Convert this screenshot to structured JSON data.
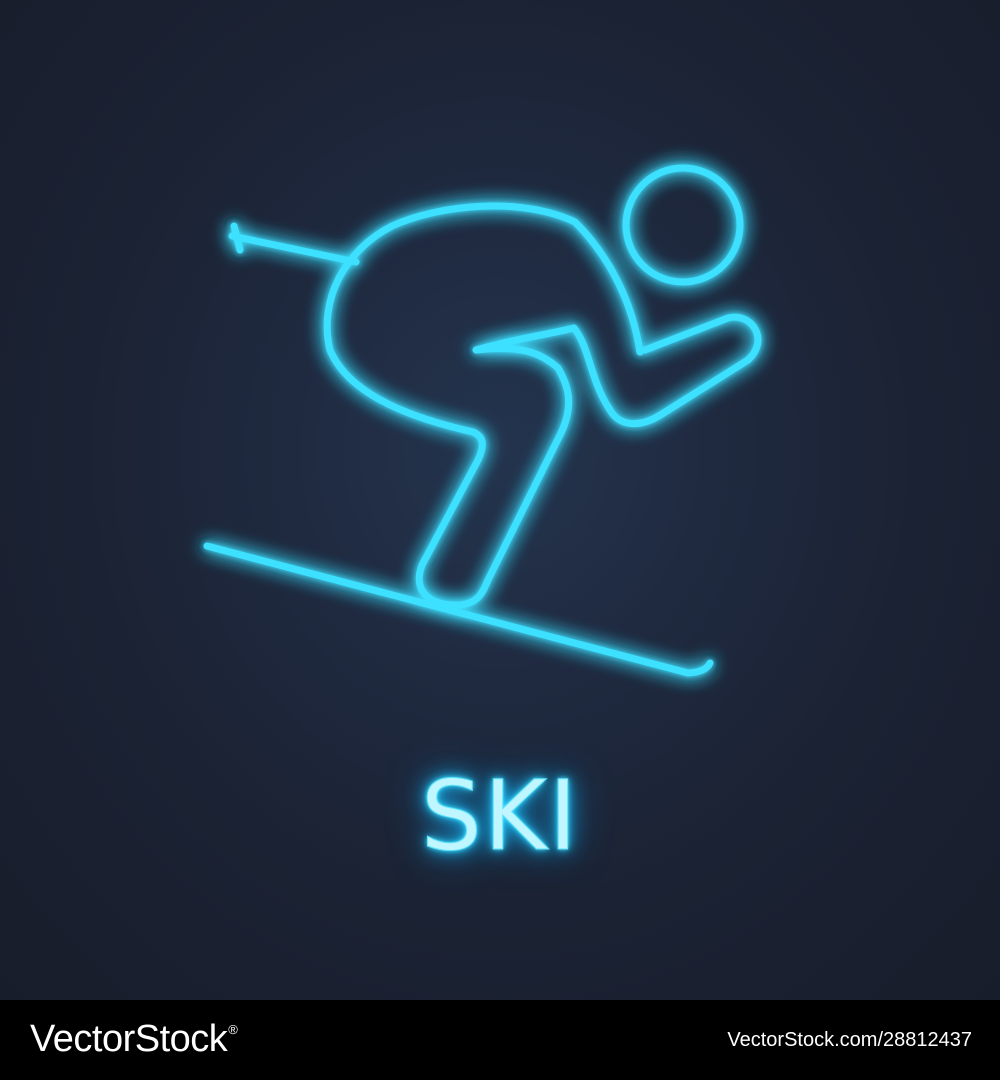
{
  "artwork": {
    "subject": "skier-icon",
    "caption": "SKI",
    "neon_color": "#3ee0ff",
    "background_color": "#1f2a40"
  },
  "footer": {
    "brand": "VectorStock",
    "brand_mark": "®",
    "image_id": "VectorStock.com/28812437"
  }
}
